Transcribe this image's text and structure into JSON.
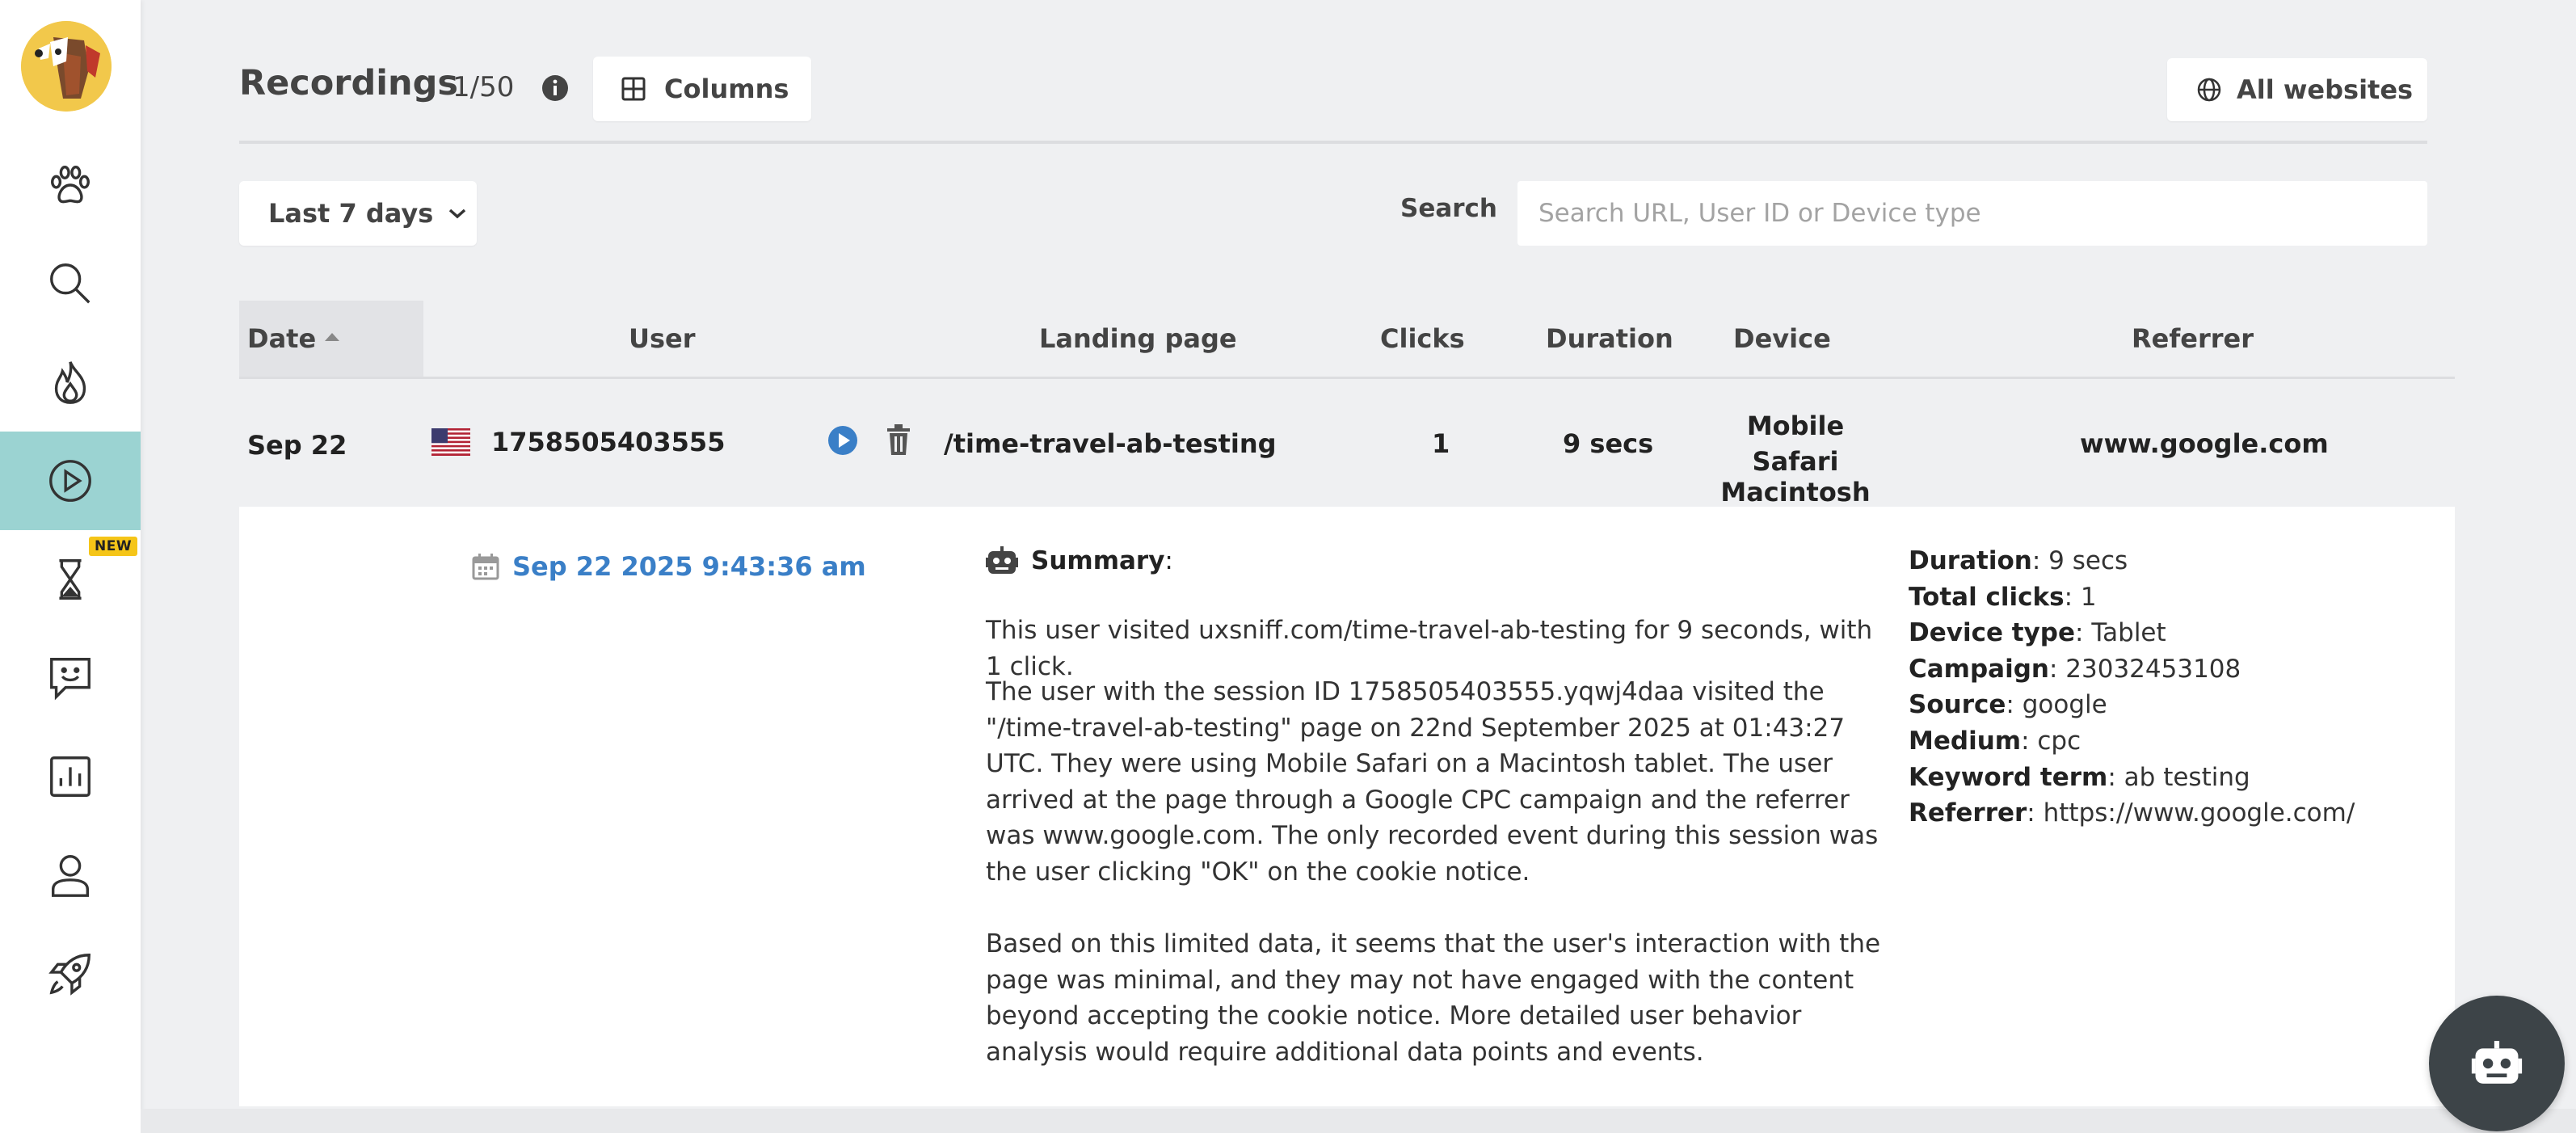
{
  "sidebar": {
    "logo": "beagle-dog-logo",
    "items": [
      {
        "name": "paw-icon"
      },
      {
        "name": "search-icon"
      },
      {
        "name": "flame-icon"
      },
      {
        "name": "play-circle-icon",
        "active": true
      },
      {
        "name": "hourglass-icon",
        "badge": "NEW"
      },
      {
        "name": "feedback-chat-icon"
      },
      {
        "name": "bar-chart-icon"
      },
      {
        "name": "user-icon"
      },
      {
        "name": "rocket-icon"
      }
    ],
    "active_color": "#9bd3d2"
  },
  "header": {
    "title": "Recordings",
    "count": "1/50",
    "columns_label": "Columns",
    "websites_label": "All websites"
  },
  "filters": {
    "range_label": "Last 7 days",
    "search_label": "Search",
    "search_placeholder": "Search URL, User ID or Device type",
    "search_value": ""
  },
  "table": {
    "columns": [
      "Date",
      "User",
      "Landing page",
      "Clicks",
      "Duration",
      "Device",
      "Referrer"
    ],
    "sort_column": "Date",
    "sort_direction": "ascending",
    "rows": [
      {
        "date": "Sep 22",
        "country_flag": "us-flag-icon",
        "user": "1758505403555",
        "landing_page": "/time-travel-ab-testing",
        "clicks": "1",
        "duration": "9 secs",
        "device_line1": "Mobile",
        "device_line2": "Safari Macintosh",
        "referrer": "www.google.com"
      }
    ]
  },
  "detail": {
    "timestamp": "Sep 22 2025 9:43:36 am",
    "summary_label": "Summary",
    "summary_p1": "This user visited uxsniff.com/time-travel-ab-testing for 9 seconds, with 1 click.",
    "summary_p2": "The user with the session ID 1758505403555.yqwj4daa visited the \"/time-travel-ab-testing\" page on 22nd September 2025 at 01:43:27 UTC. They were using Mobile Safari on a Macintosh tablet. The user arrived at the page through a Google CPC campaign and the referrer was www.google.com. The only recorded event during this session was the user clicking \"OK\" on the cookie notice.",
    "summary_p3": "Based on this limited data, it seems that the user's interaction with the page was minimal, and they may not have engaged with the content beyond accepting the cookie notice. More detailed user behavior analysis would require additional data points and events.",
    "meta": [
      {
        "key": "Duration",
        "value": "9 secs"
      },
      {
        "key": "Total clicks",
        "value": "1"
      },
      {
        "key": "Device type",
        "value": "Tablet"
      },
      {
        "key": "Campaign",
        "value": "23032453108"
      },
      {
        "key": "Source",
        "value": "google"
      },
      {
        "key": "Medium",
        "value": "cpc"
      },
      {
        "key": "Keyword term",
        "value": "ab testing"
      },
      {
        "key": "Referrer",
        "value": "https://www.google.com/"
      }
    ]
  },
  "colors": {
    "accent_link": "#3a7fc7",
    "play_button": "#3a7fc7",
    "badge": "#f5c518",
    "fab": "#3d4448"
  }
}
